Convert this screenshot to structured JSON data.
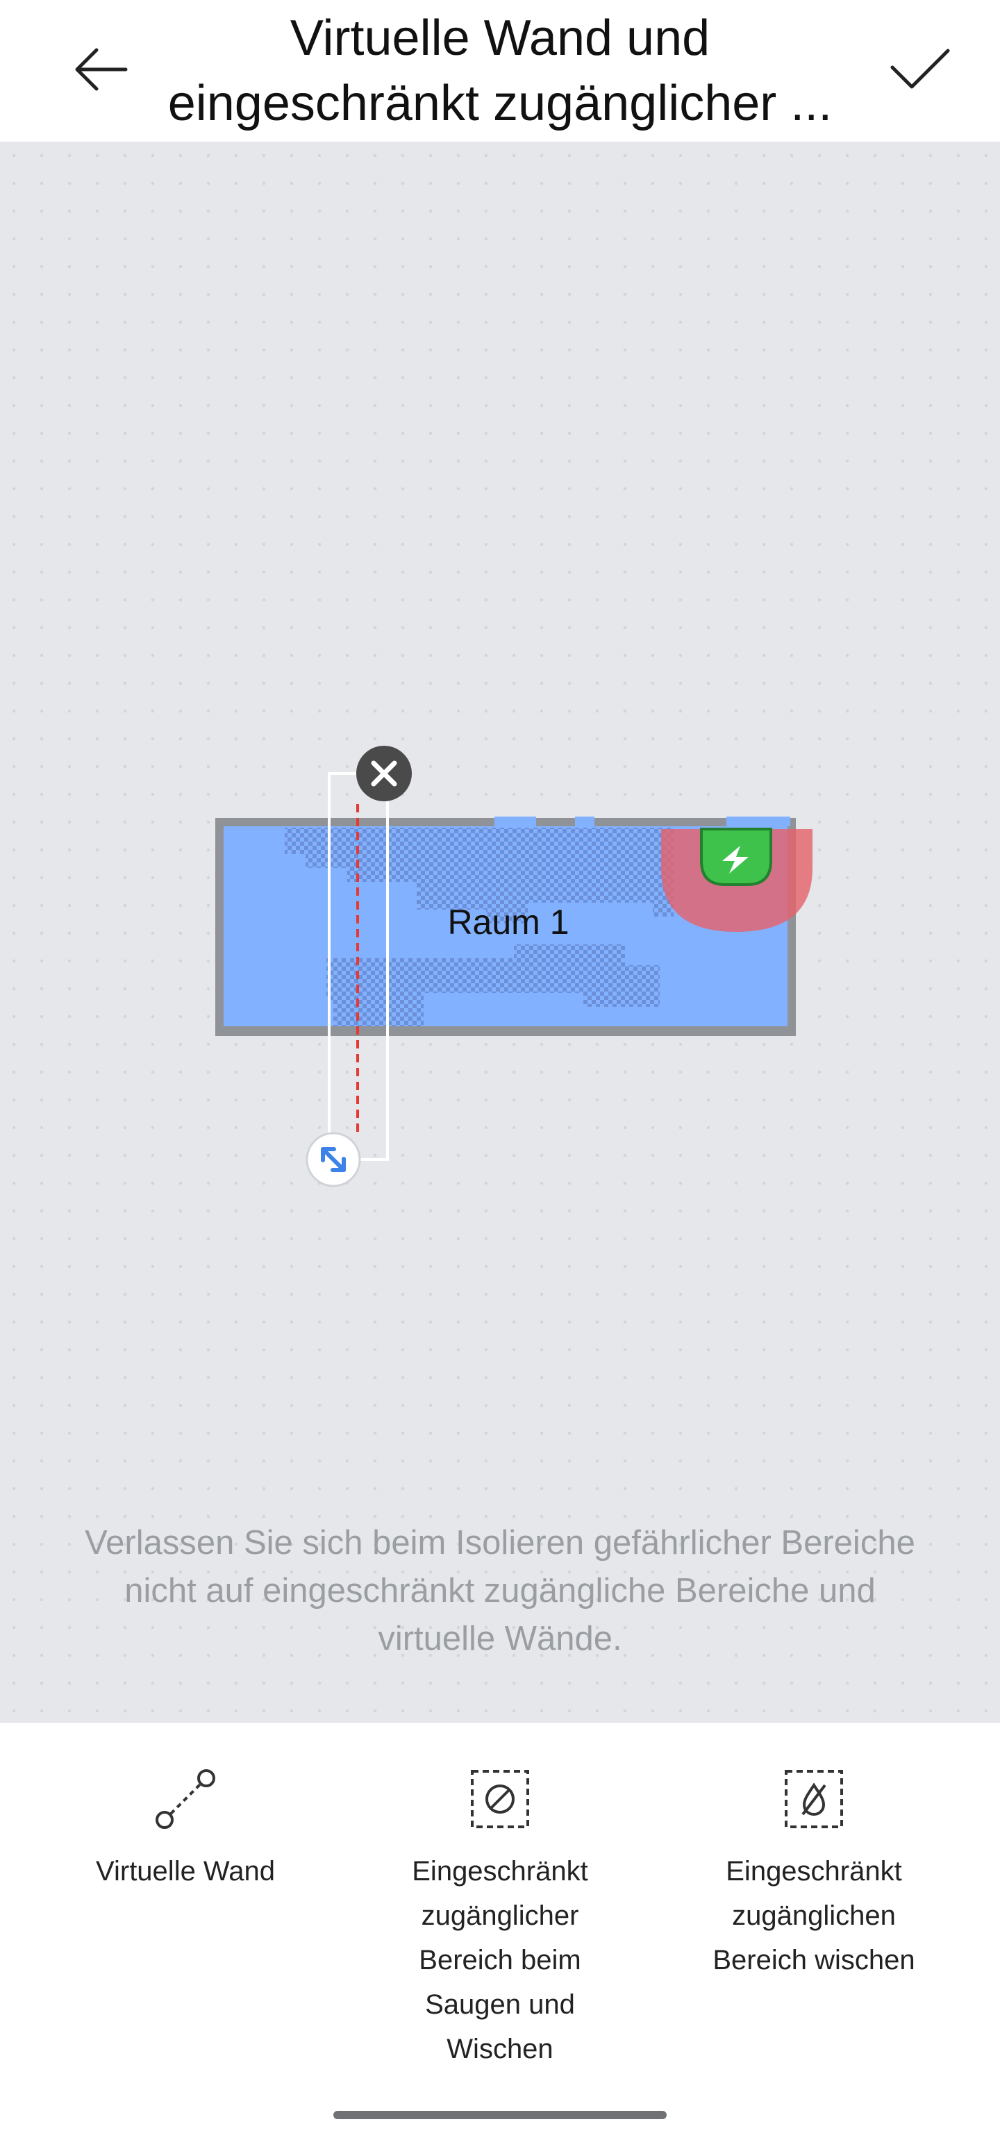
{
  "header": {
    "title_line1": "Virtuelle Wand und",
    "title_line2": "eingeschränkt zugänglicher ...",
    "back_icon": "arrow-left-icon",
    "confirm_icon": "checkmark-icon"
  },
  "map": {
    "room_label": "Raum 1",
    "delete_icon": "close-icon",
    "resize_icon": "resize-arrows-icon",
    "dock_icon": "lightning-icon",
    "colors": {
      "background": "#e5e7ea",
      "room_fill": "#82b1ff",
      "room_wall": "#8f9296",
      "restricted_zone": "#e4636d",
      "dock": "#3fc24b",
      "virtual_wall": "#e53935"
    }
  },
  "notice": {
    "line1": "Verlassen Sie sich beim Isolieren gefährlicher Bereiche",
    "line2": "nicht auf eingeschränkt zugängliche Bereiche und",
    "line3": "virtuelle Wände."
  },
  "toolbar": {
    "items": [
      {
        "icon": "virtual-wall-icon",
        "lines": [
          "Virtuelle Wand"
        ]
      },
      {
        "icon": "no-go-zone-icon",
        "lines": [
          "Eingeschränkt",
          "zugänglicher",
          "Bereich beim",
          "Saugen und",
          "Wischen"
        ]
      },
      {
        "icon": "no-mop-zone-icon",
        "lines": [
          "Eingeschränkt",
          "zugänglichen",
          "Bereich wischen"
        ]
      }
    ]
  }
}
